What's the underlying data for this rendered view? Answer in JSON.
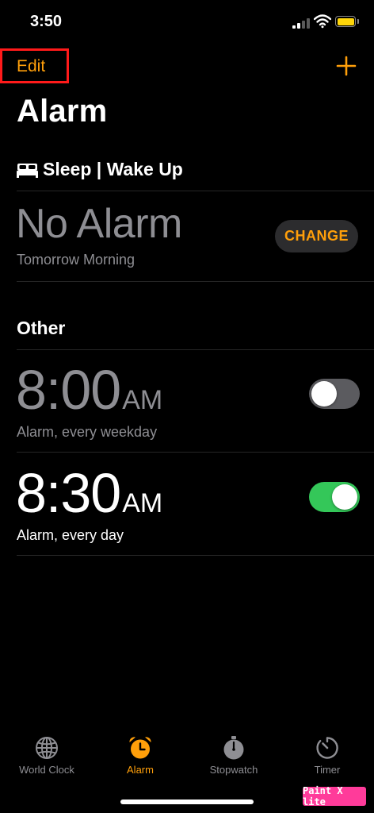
{
  "status_bar": {
    "time": "3:50"
  },
  "nav": {
    "edit_label": "Edit",
    "add_icon": "plus-icon"
  },
  "page": {
    "title": "Alarm"
  },
  "sleep": {
    "icon": "bed-icon",
    "title": "Sleep | Wake Up",
    "state": "No Alarm",
    "subtitle": "Tomorrow Morning",
    "change_label": "CHANGE"
  },
  "other": {
    "title": "Other",
    "alarms": [
      {
        "time": "8:00",
        "period": "AM",
        "label": "Alarm, every weekday",
        "enabled": false
      },
      {
        "time": "8:30",
        "period": "AM",
        "label": "Alarm, every day",
        "enabled": true
      }
    ]
  },
  "tabs": [
    {
      "label": "World Clock",
      "icon": "globe-icon",
      "active": false
    },
    {
      "label": "Alarm",
      "icon": "alarm-clock-icon",
      "active": true
    },
    {
      "label": "Stopwatch",
      "icon": "stopwatch-icon",
      "active": false
    },
    {
      "label": "Timer",
      "icon": "timer-icon",
      "active": false
    }
  ],
  "watermark": {
    "text": "Paint X lite"
  },
  "colors": {
    "accent": "#ff9f0a",
    "toggle_on": "#34c759",
    "highlight": "#ff1a1a",
    "background": "#000000"
  }
}
